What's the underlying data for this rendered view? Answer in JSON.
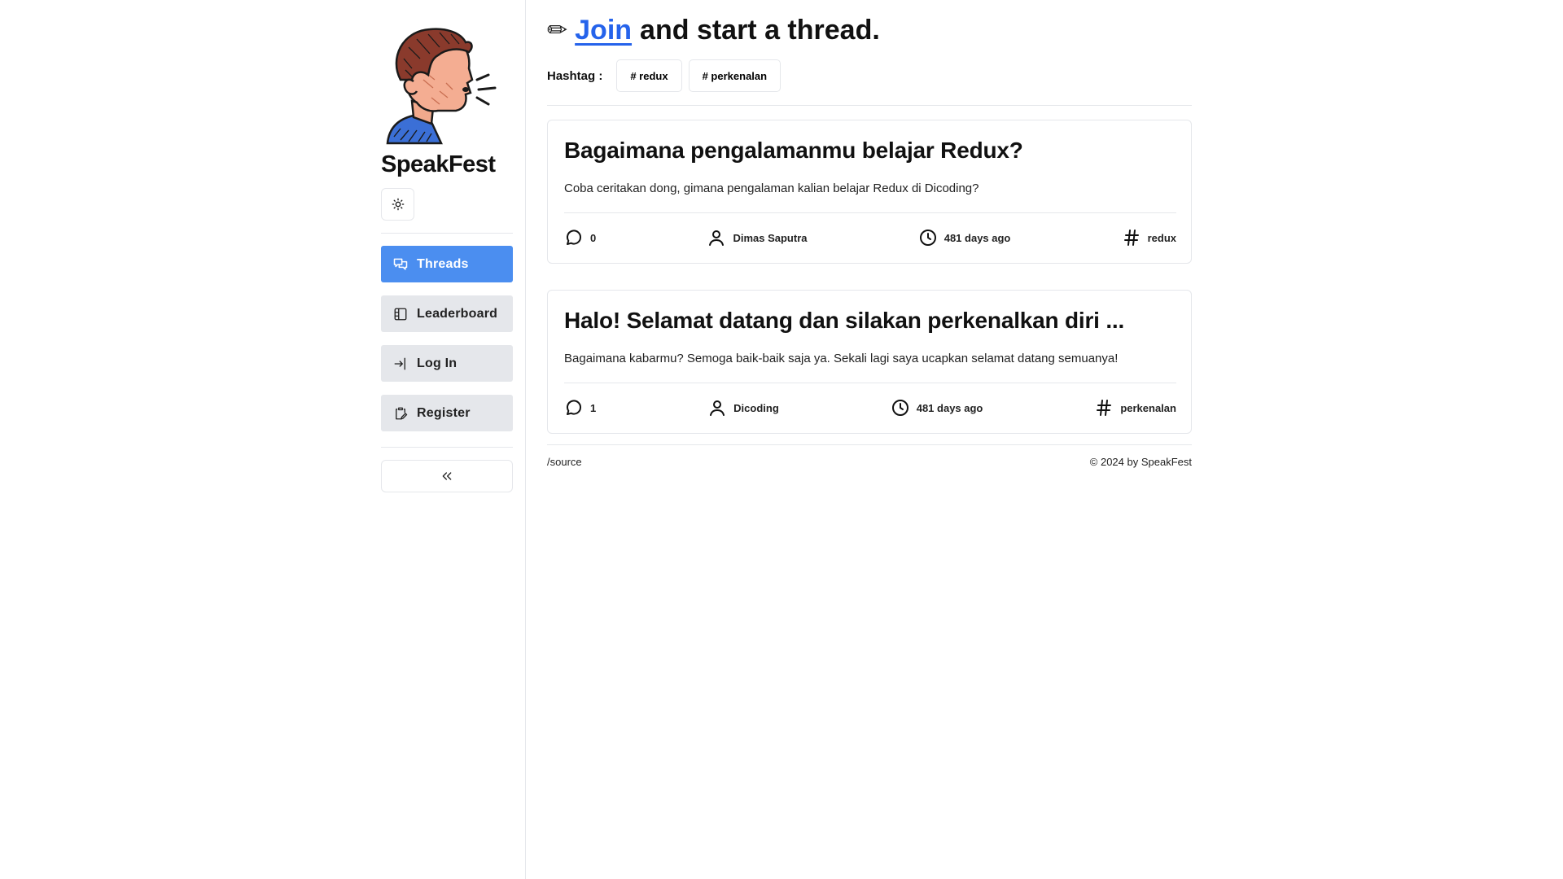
{
  "brand": {
    "name": "SpeakFest"
  },
  "sidebar": {
    "items": [
      {
        "label": "Threads",
        "icon": "threads-icon",
        "active": true
      },
      {
        "label": "Leaderboard",
        "icon": "leaderboard-icon",
        "active": false
      },
      {
        "label": "Log In",
        "icon": "login-icon",
        "active": false
      },
      {
        "label": "Register",
        "icon": "register-icon",
        "active": false
      }
    ],
    "theme_icon": "sun-icon",
    "collapse_icon": "double-chevron-left-icon"
  },
  "header": {
    "pencil": "✏",
    "join_link": "Join",
    "heading_rest": "and start a thread."
  },
  "hashtags": {
    "label": "Hashtag :",
    "tags": [
      "# redux",
      "# perkenalan"
    ]
  },
  "threads": [
    {
      "title": "Bagaimana pengalamanmu belajar Redux?",
      "body": "Coba ceritakan dong, gimana pengalaman kalian belajar Redux di Dicoding?",
      "comments": "0",
      "author": "Dimas Saputra",
      "time": "481 days ago",
      "category": "redux"
    },
    {
      "title": "Halo! Selamat datang dan silakan perkenalkan diri ...",
      "body": "Bagaimana kabarmu? Semoga baik-baik saja ya. Sekali lagi saya ucapkan selamat datang semuanya!",
      "comments": "1",
      "author": "Dicoding",
      "time": "481 days ago",
      "category": "perkenalan"
    }
  ],
  "footer": {
    "source_link": "/source",
    "copyright": "© 2024 by SpeakFest"
  },
  "colors": {
    "accent": "#4b8ef0",
    "link": "#2563eb",
    "nav_bg": "#e5e7eb",
    "border": "#e5e7eb"
  }
}
